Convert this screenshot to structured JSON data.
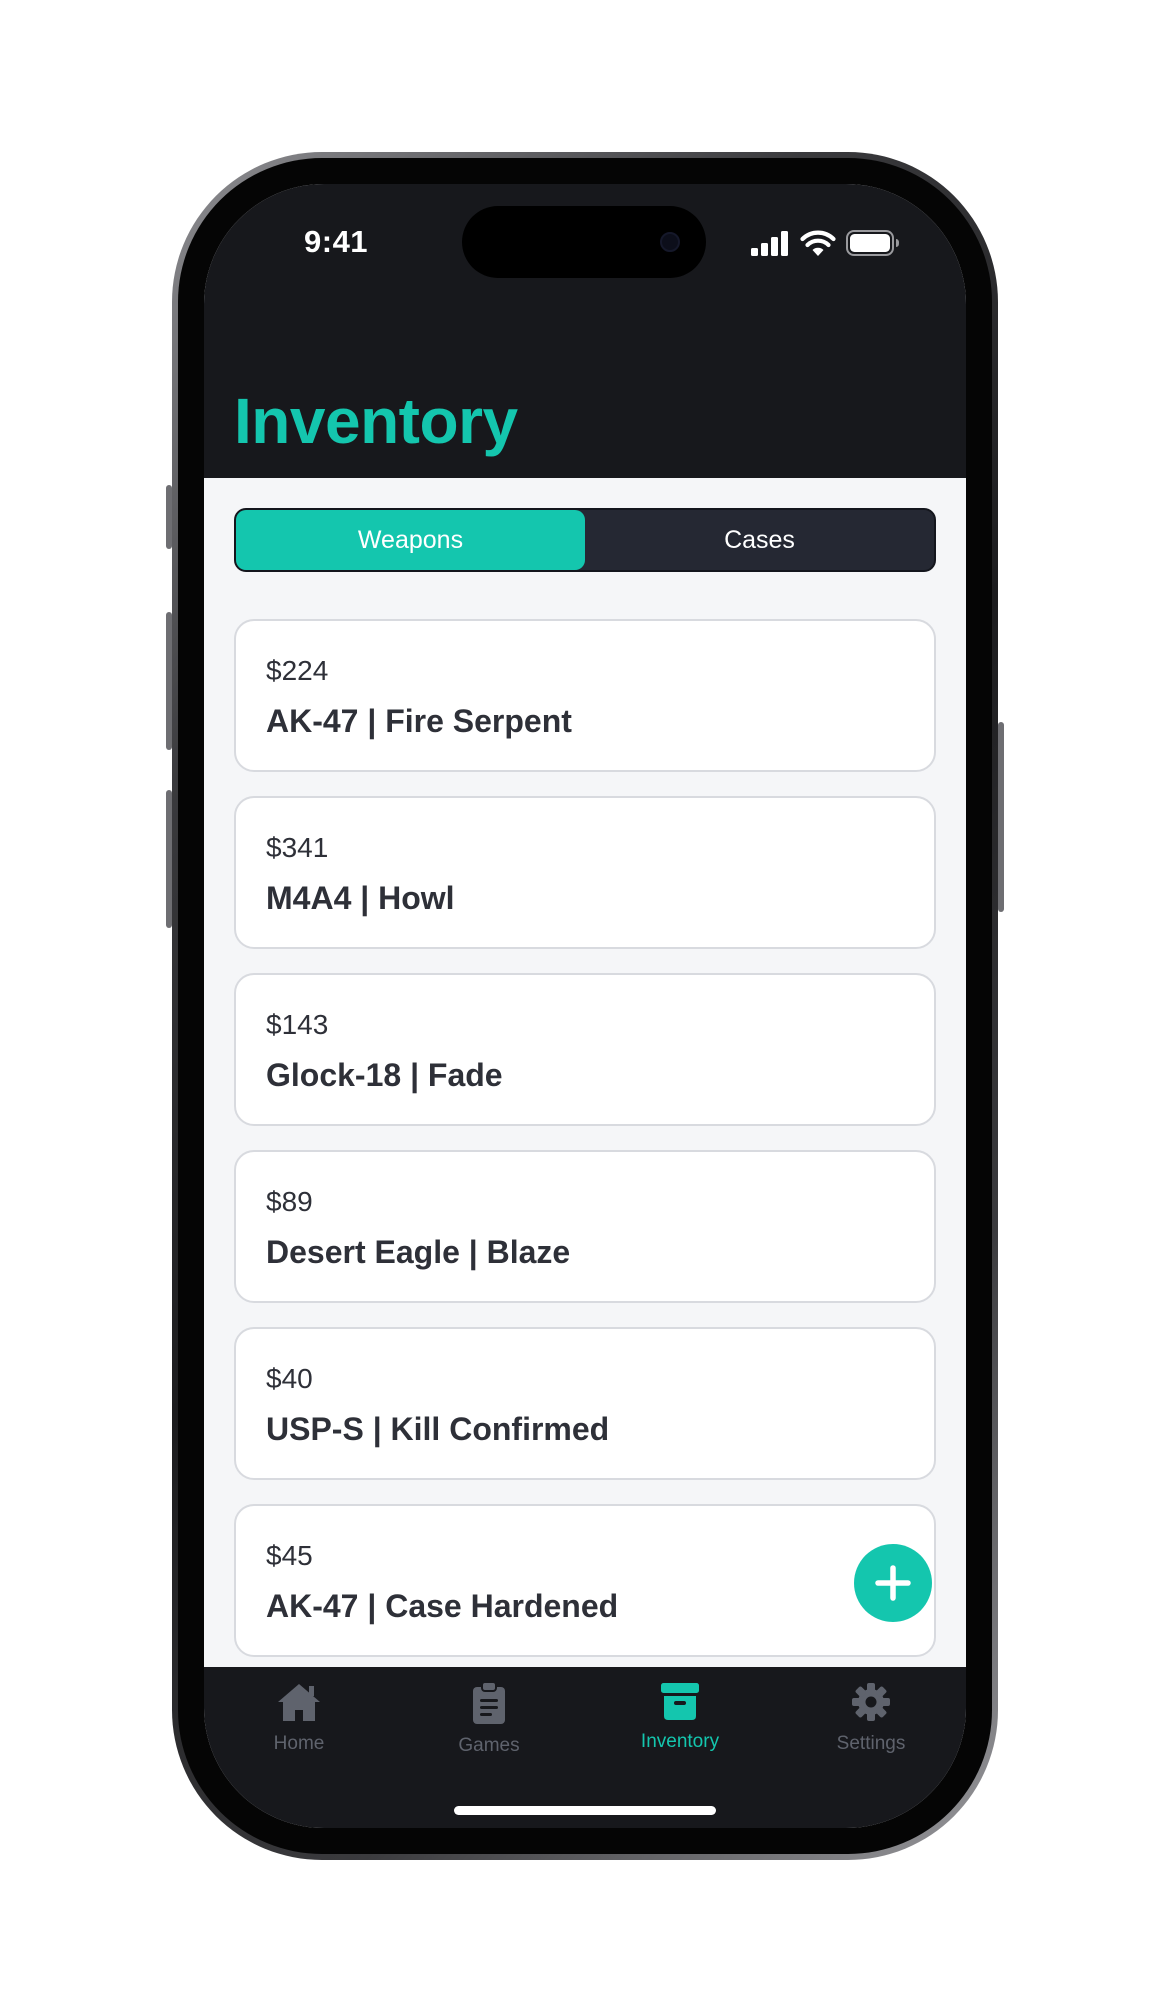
{
  "status_bar": {
    "time": "9:41"
  },
  "header": {
    "title": "Inventory"
  },
  "segmented_control": {
    "options": [
      {
        "label": "Weapons",
        "active": true
      },
      {
        "label": "Cases",
        "active": false
      }
    ]
  },
  "items": [
    {
      "price": "$224",
      "name": "AK-47 | Fire Serpent"
    },
    {
      "price": "$341",
      "name": "M4A4 | Howl"
    },
    {
      "price": "$143",
      "name": "Glock-18 | Fade"
    },
    {
      "price": "$89",
      "name": "Desert Eagle | Blaze"
    },
    {
      "price": "$40",
      "name": "USP-S | Kill Confirmed"
    },
    {
      "price": "$45",
      "name": "AK-47 | Case Hardened"
    }
  ],
  "fab": {
    "icon": "plus-icon"
  },
  "tab_bar": {
    "tabs": [
      {
        "label": "Home",
        "icon": "house-icon",
        "active": false
      },
      {
        "label": "Games",
        "icon": "clipboard-icon",
        "active": false
      },
      {
        "label": "Inventory",
        "icon": "archive-box-icon",
        "active": true
      },
      {
        "label": "Settings",
        "icon": "gear-icon",
        "active": false
      }
    ]
  },
  "colors": {
    "accent": "#14c6ae",
    "header_bg": "#17181c",
    "segment_bg": "#252833",
    "content_bg": "#f5f6f8",
    "card_text": "#2e3038",
    "inactive_tab": "#5f636d"
  }
}
